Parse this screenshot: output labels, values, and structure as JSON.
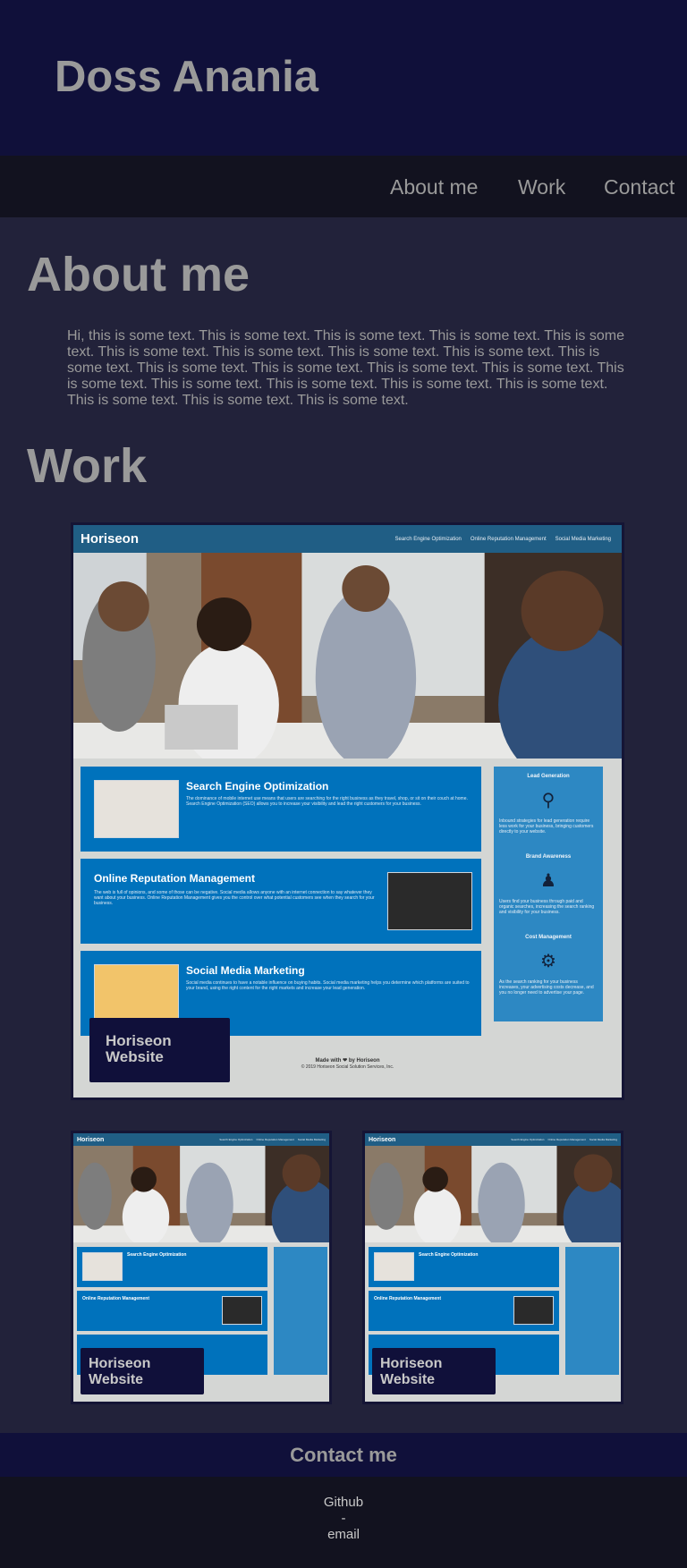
{
  "header": {
    "title": "Doss Anania"
  },
  "nav": {
    "items": [
      "About me",
      "Work",
      "Contact"
    ]
  },
  "about": {
    "title": "About me",
    "text": "Hi, this is some text. This is some text. This is some text. This is some text. This is some text. This is some text. This is some text. This is some text. This is some text. This is some text. This is some text. This is some text. This is some text. This is some text. This is some text. This is some text. This is some text. This is some text. This is some text. This is some text. This is some text. This is some text."
  },
  "work": {
    "title": "Work",
    "projects": [
      {
        "label": "Horiseon Website"
      },
      {
        "label": "Horiseon Website"
      },
      {
        "label": "Horiseon Website"
      }
    ],
    "screenshot": {
      "logo": "Horiseon",
      "nav": [
        "Search Engine Optimization",
        "Online Reputation Management",
        "Social Media Marketing"
      ],
      "sections": [
        {
          "title": "Search Engine Optimization",
          "text": "The dominance of mobile internet use means that users are searching for the right business as they travel, shop, or sit on their couch at home. Search Engine Optimization (SEO) allows you to increase your visibility and lead the right customers for your business."
        },
        {
          "title": "Online Reputation Management",
          "text": "The web is full of opinions, and some of those can be negative. Social media allows anyone with an internet connection to say whatever they want about your business. Online Reputation Management gives you the control over what potential customers see when they search for your business."
        },
        {
          "title": "Social Media Marketing",
          "text": "Social media continues to have a notable influence on buying habits. Social media marketing helps you determine which platforms are suited to your brand, using the right content for the right markets and increase your lead generation."
        }
      ],
      "benefits": [
        {
          "title": "Lead Generation",
          "text": "Inbound strategies for lead generation require less work for your business, bringing customers directly to your website."
        },
        {
          "title": "Brand Awareness",
          "text": "Users find your business through paid and organic searches, increasing the search ranking and visibility for your business."
        },
        {
          "title": "Cost Management",
          "text": "As the search ranking for your business increases, your advertising costs decrease, and you no longer need to advertise your page."
        }
      ],
      "footer_line1": "Made with ❤ by Horiseon",
      "footer_line2": "© 2019 Horiseon Social Solution Services, Inc."
    }
  },
  "contact": {
    "title": "Contact me",
    "links": [
      "Github",
      "-",
      "email"
    ]
  },
  "colors": {
    "header_bg": "#10103a",
    "nav_bg": "#12121f",
    "page_bg": "#22223a",
    "text": "#9a9a9a",
    "horiseon_bar": "#205e85",
    "horiseon_box": "#0072bc",
    "horiseon_side": "#2d88c3"
  }
}
